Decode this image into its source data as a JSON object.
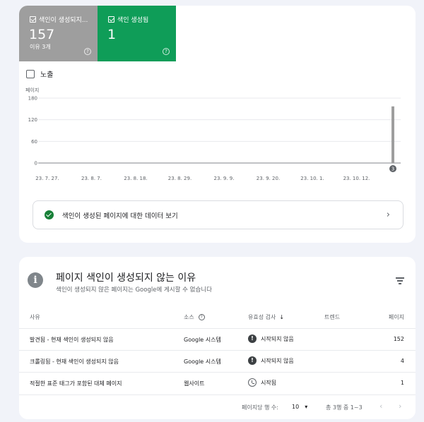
{
  "summary": {
    "not_indexed": {
      "label": "색인이 생성되지...",
      "count": "157",
      "sub": "이유 3개"
    },
    "indexed": {
      "label": "색인 생성됨",
      "count": "1"
    }
  },
  "impressions_label": "노출",
  "chart_data": {
    "type": "bar",
    "ylabel": "페이지",
    "yticks": [
      "180",
      "120",
      "60",
      "0"
    ],
    "ylim": [
      0,
      180
    ],
    "xticks": [
      "23. 7. 27.",
      "23. 8. 7.",
      "23. 8. 18.",
      "23. 8. 29.",
      "23. 9. 9.",
      "23. 9. 20.",
      "23. 10. 1.",
      "23. 10. 12."
    ],
    "bars": [
      {
        "x": "latest",
        "value": 157
      }
    ],
    "annotation": "3",
    "colors": {
      "not_indexed": "#9e9e9e",
      "indexed": "#0f9d58"
    }
  },
  "indexed_link": "색인이 생성된 페이지에 대한 데이터 보기",
  "reasons": {
    "title": "페이지 색인이 생성되지 않는 이유",
    "subtitle": "색인이 생성되지 않은 페이지는 Google에 게시할 수 없습니다",
    "columns": {
      "reason": "사유",
      "source": "소스",
      "validation": "유효성 검사",
      "trend": "트렌드",
      "pages": "페이지"
    },
    "rows": [
      {
        "reason": "발견됨 - 현재 색인이 생성되지 않음",
        "source": "Google 시스템",
        "status": "시작되지 않음",
        "status_icon": "warning-icon",
        "pages": "152"
      },
      {
        "reason": "크롤링됨 - 현재 색인이 생성되지 않음",
        "source": "Google 시스템",
        "status": "시작되지 않음",
        "status_icon": "warning-icon",
        "pages": "4"
      },
      {
        "reason": "적절한 표준 태그가 포함된 대체 페이지",
        "source": "웹사이트",
        "status": "시작됨",
        "status_icon": "clock-icon",
        "pages": "1"
      }
    ],
    "footer": {
      "rows_label": "페이지당 행 수:",
      "rows_value": "10",
      "range": "총 3행 중 1~3"
    }
  }
}
